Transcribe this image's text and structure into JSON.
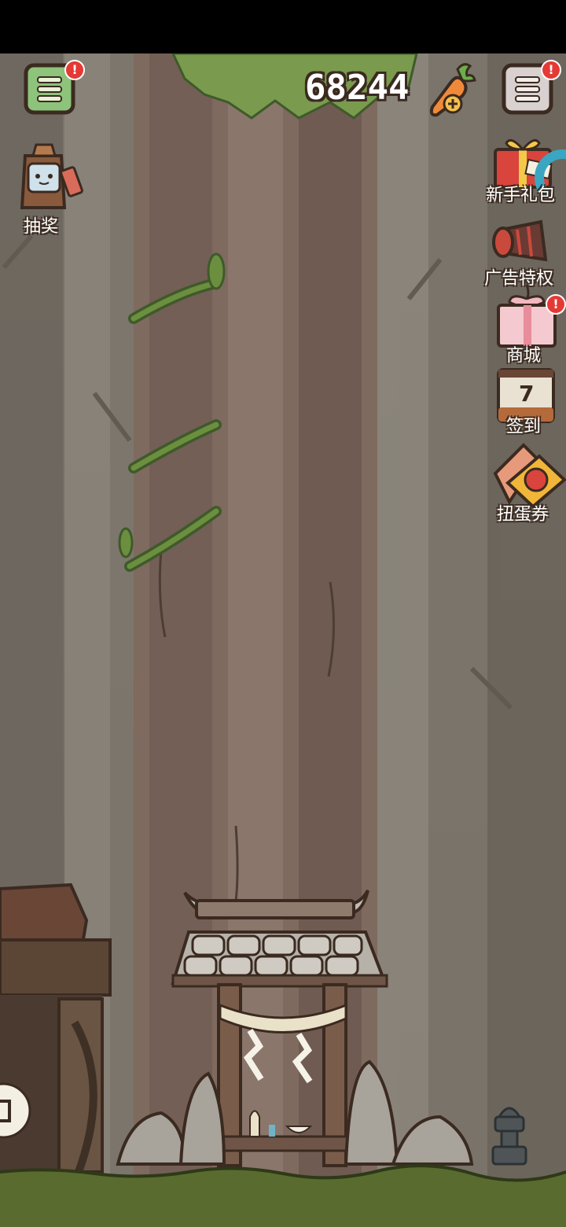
{
  "top_bar": {
    "currency_amount": "68244",
    "left_menu_icon": "menu-icon",
    "right_menu_icon": "menu-icon",
    "carrot_add_icon": "carrot-plus-icon"
  },
  "left_buttons": [
    {
      "label": "抽奖",
      "icon": "lottery-box-icon"
    }
  ],
  "right_buttons": [
    {
      "label": "新手礼包",
      "icon": "gift-box-icon"
    },
    {
      "label": "广告特权",
      "icon": "megaphone-icon"
    },
    {
      "label": "商城",
      "icon": "shop-gift-icon"
    },
    {
      "label": "签到",
      "icon": "calendar-icon",
      "day": "7"
    },
    {
      "label": "扭蛋券",
      "icon": "gacha-ticket-icon"
    }
  ],
  "colors": {
    "badge": "#e53935",
    "grass": "#5a6b2f",
    "forest_bg": "#7a7166"
  }
}
